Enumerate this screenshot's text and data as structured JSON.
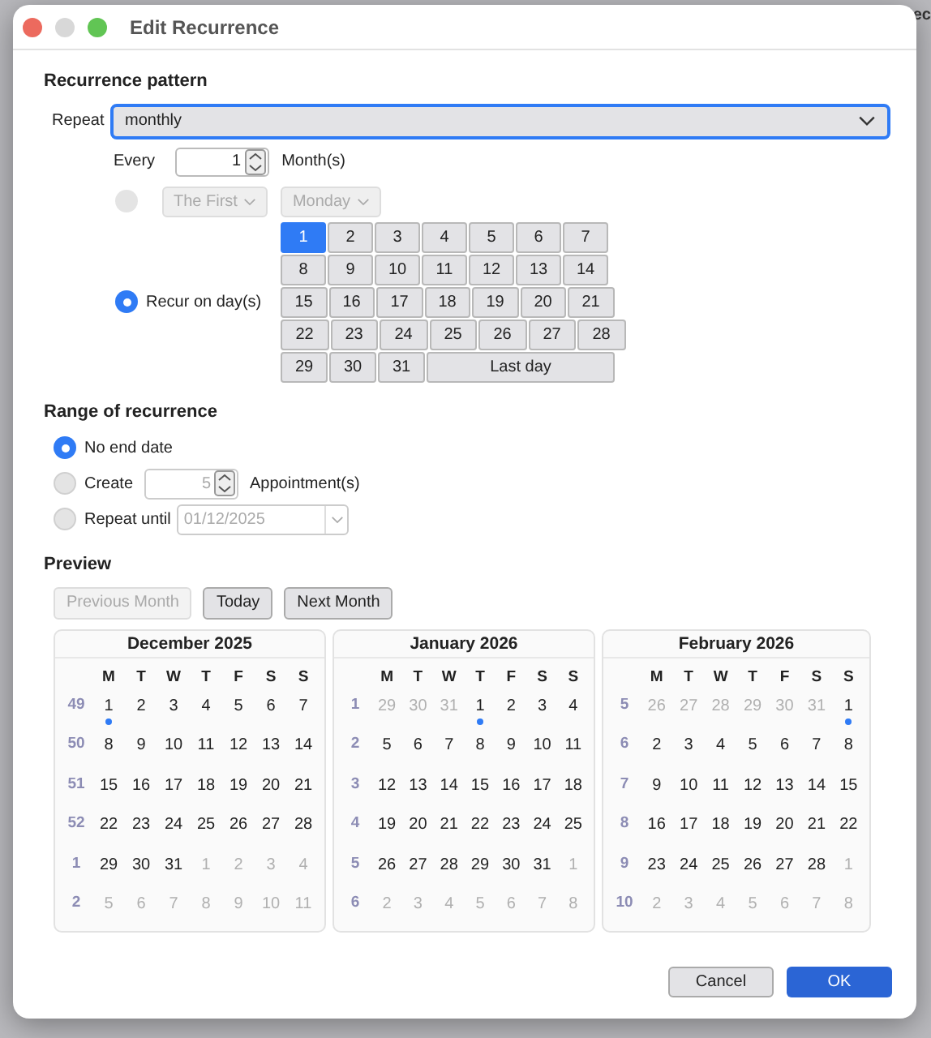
{
  "background": {
    "text_fragment": "ec"
  },
  "window": {
    "title": "Edit Recurrence"
  },
  "pattern": {
    "heading": "Recurrence pattern",
    "repeat_label": "Repeat",
    "repeat_value": "monthly",
    "every_label": "Every",
    "every_value": "1",
    "every_unit": "Month(s)",
    "weekday_option": {
      "selected": false,
      "disabled": true,
      "ordinal": "The First",
      "weekday": "Monday"
    },
    "days_option": {
      "selected": true,
      "label": "Recur on day(s)"
    },
    "day_rows": [
      [
        {
          "label": "1",
          "selected": true
        },
        {
          "label": "2",
          "selected": false
        },
        {
          "label": "3",
          "selected": false
        },
        {
          "label": "4",
          "selected": false
        },
        {
          "label": "5",
          "selected": false
        },
        {
          "label": "6",
          "selected": false
        },
        {
          "label": "7",
          "selected": false
        }
      ],
      [
        {
          "label": "8",
          "selected": false
        },
        {
          "label": "9",
          "selected": false
        },
        {
          "label": "10",
          "selected": false
        },
        {
          "label": "11",
          "selected": false
        },
        {
          "label": "12",
          "selected": false
        },
        {
          "label": "13",
          "selected": false
        },
        {
          "label": "14",
          "selected": false
        }
      ],
      [
        {
          "label": "15",
          "selected": false
        },
        {
          "label": "16",
          "selected": false
        },
        {
          "label": "17",
          "selected": false
        },
        {
          "label": "18",
          "selected": false
        },
        {
          "label": "19",
          "selected": false
        },
        {
          "label": "20",
          "selected": false
        },
        {
          "label": "21",
          "selected": false
        }
      ],
      [
        {
          "label": "22",
          "selected": false
        },
        {
          "label": "23",
          "selected": false
        },
        {
          "label": "24",
          "selected": false
        },
        {
          "label": "25",
          "selected": false
        },
        {
          "label": "26",
          "selected": false
        },
        {
          "label": "27",
          "selected": false
        },
        {
          "label": "28",
          "selected": false
        }
      ],
      [
        {
          "label": "29",
          "selected": false
        },
        {
          "label": "30",
          "selected": false
        },
        {
          "label": "31",
          "selected": false
        },
        {
          "label": "Last day",
          "selected": false,
          "kind": "wide"
        }
      ]
    ]
  },
  "range": {
    "heading": "Range of recurrence",
    "options": [
      {
        "kind": "plain",
        "label": "No end date",
        "selected": true
      },
      {
        "kind": "count",
        "label": "Create",
        "value": "5",
        "unit": "Appointment(s)",
        "selected": false
      },
      {
        "kind": "date",
        "label": "Repeat until",
        "value": "01/12/2025",
        "selected": false
      }
    ]
  },
  "preview": {
    "heading": "Preview",
    "buttons": [
      {
        "label": "Previous Month",
        "disabled": true
      },
      {
        "label": "Today",
        "disabled": false
      },
      {
        "label": "Next Month",
        "disabled": false
      }
    ],
    "months": [
      {
        "title": "December 2025",
        "weekdays": [
          "M",
          "T",
          "W",
          "T",
          "F",
          "S",
          "S"
        ],
        "weeks": [
          {
            "week": "49",
            "days": [
              {
                "d": "1",
                "other": false,
                "marked": true
              },
              {
                "d": "2",
                "other": false,
                "marked": false
              },
              {
                "d": "3",
                "other": false,
                "marked": false
              },
              {
                "d": "4",
                "other": false,
                "marked": false
              },
              {
                "d": "5",
                "other": false,
                "marked": false
              },
              {
                "d": "6",
                "other": false,
                "marked": false
              },
              {
                "d": "7",
                "other": false,
                "marked": false
              }
            ]
          },
          {
            "week": "50",
            "days": [
              {
                "d": "8",
                "other": false,
                "marked": false
              },
              {
                "d": "9",
                "other": false,
                "marked": false
              },
              {
                "d": "10",
                "other": false,
                "marked": false
              },
              {
                "d": "11",
                "other": false,
                "marked": false
              },
              {
                "d": "12",
                "other": false,
                "marked": false
              },
              {
                "d": "13",
                "other": false,
                "marked": false
              },
              {
                "d": "14",
                "other": false,
                "marked": false
              }
            ]
          },
          {
            "week": "51",
            "days": [
              {
                "d": "15",
                "other": false,
                "marked": false
              },
              {
                "d": "16",
                "other": false,
                "marked": false
              },
              {
                "d": "17",
                "other": false,
                "marked": false
              },
              {
                "d": "18",
                "other": false,
                "marked": false
              },
              {
                "d": "19",
                "other": false,
                "marked": false
              },
              {
                "d": "20",
                "other": false,
                "marked": false
              },
              {
                "d": "21",
                "other": false,
                "marked": false
              }
            ]
          },
          {
            "week": "52",
            "days": [
              {
                "d": "22",
                "other": false,
                "marked": false
              },
              {
                "d": "23",
                "other": false,
                "marked": false
              },
              {
                "d": "24",
                "other": false,
                "marked": false
              },
              {
                "d": "25",
                "other": false,
                "marked": false
              },
              {
                "d": "26",
                "other": false,
                "marked": false
              },
              {
                "d": "27",
                "other": false,
                "marked": false
              },
              {
                "d": "28",
                "other": false,
                "marked": false
              }
            ]
          },
          {
            "week": "1",
            "days": [
              {
                "d": "29",
                "other": false,
                "marked": false
              },
              {
                "d": "30",
                "other": false,
                "marked": false
              },
              {
                "d": "31",
                "other": false,
                "marked": false
              },
              {
                "d": "1",
                "other": true,
                "marked": false
              },
              {
                "d": "2",
                "other": true,
                "marked": false
              },
              {
                "d": "3",
                "other": true,
                "marked": false
              },
              {
                "d": "4",
                "other": true,
                "marked": false
              }
            ]
          },
          {
            "week": "2",
            "days": [
              {
                "d": "5",
                "other": true,
                "marked": false
              },
              {
                "d": "6",
                "other": true,
                "marked": false
              },
              {
                "d": "7",
                "other": true,
                "marked": false
              },
              {
                "d": "8",
                "other": true,
                "marked": false
              },
              {
                "d": "9",
                "other": true,
                "marked": false
              },
              {
                "d": "10",
                "other": true,
                "marked": false
              },
              {
                "d": "11",
                "other": true,
                "marked": false
              }
            ]
          }
        ]
      },
      {
        "title": "January 2026",
        "weekdays": [
          "M",
          "T",
          "W",
          "T",
          "F",
          "S",
          "S"
        ],
        "weeks": [
          {
            "week": "1",
            "days": [
              {
                "d": "29",
                "other": true,
                "marked": false
              },
              {
                "d": "30",
                "other": true,
                "marked": false
              },
              {
                "d": "31",
                "other": true,
                "marked": false
              },
              {
                "d": "1",
                "other": false,
                "marked": true
              },
              {
                "d": "2",
                "other": false,
                "marked": false
              },
              {
                "d": "3",
                "other": false,
                "marked": false
              },
              {
                "d": "4",
                "other": false,
                "marked": false
              }
            ]
          },
          {
            "week": "2",
            "days": [
              {
                "d": "5",
                "other": false,
                "marked": false
              },
              {
                "d": "6",
                "other": false,
                "marked": false
              },
              {
                "d": "7",
                "other": false,
                "marked": false
              },
              {
                "d": "8",
                "other": false,
                "marked": false
              },
              {
                "d": "9",
                "other": false,
                "marked": false
              },
              {
                "d": "10",
                "other": false,
                "marked": false
              },
              {
                "d": "11",
                "other": false,
                "marked": false
              }
            ]
          },
          {
            "week": "3",
            "days": [
              {
                "d": "12",
                "other": false,
                "marked": false
              },
              {
                "d": "13",
                "other": false,
                "marked": false
              },
              {
                "d": "14",
                "other": false,
                "marked": false
              },
              {
                "d": "15",
                "other": false,
                "marked": false
              },
              {
                "d": "16",
                "other": false,
                "marked": false
              },
              {
                "d": "17",
                "other": false,
                "marked": false
              },
              {
                "d": "18",
                "other": false,
                "marked": false
              }
            ]
          },
          {
            "week": "4",
            "days": [
              {
                "d": "19",
                "other": false,
                "marked": false
              },
              {
                "d": "20",
                "other": false,
                "marked": false
              },
              {
                "d": "21",
                "other": false,
                "marked": false
              },
              {
                "d": "22",
                "other": false,
                "marked": false
              },
              {
                "d": "23",
                "other": false,
                "marked": false
              },
              {
                "d": "24",
                "other": false,
                "marked": false
              },
              {
                "d": "25",
                "other": false,
                "marked": false
              }
            ]
          },
          {
            "week": "5",
            "days": [
              {
                "d": "26",
                "other": false,
                "marked": false
              },
              {
                "d": "27",
                "other": false,
                "marked": false
              },
              {
                "d": "28",
                "other": false,
                "marked": false
              },
              {
                "d": "29",
                "other": false,
                "marked": false
              },
              {
                "d": "30",
                "other": false,
                "marked": false
              },
              {
                "d": "31",
                "other": false,
                "marked": false
              },
              {
                "d": "1",
                "other": true,
                "marked": false
              }
            ]
          },
          {
            "week": "6",
            "days": [
              {
                "d": "2",
                "other": true,
                "marked": false
              },
              {
                "d": "3",
                "other": true,
                "marked": false
              },
              {
                "d": "4",
                "other": true,
                "marked": false
              },
              {
                "d": "5",
                "other": true,
                "marked": false
              },
              {
                "d": "6",
                "other": true,
                "marked": false
              },
              {
                "d": "7",
                "other": true,
                "marked": false
              },
              {
                "d": "8",
                "other": true,
                "marked": false
              }
            ]
          }
        ]
      },
      {
        "title": "February 2026",
        "weekdays": [
          "M",
          "T",
          "W",
          "T",
          "F",
          "S",
          "S"
        ],
        "weeks": [
          {
            "week": "5",
            "days": [
              {
                "d": "26",
                "other": true,
                "marked": false
              },
              {
                "d": "27",
                "other": true,
                "marked": false
              },
              {
                "d": "28",
                "other": true,
                "marked": false
              },
              {
                "d": "29",
                "other": true,
                "marked": false
              },
              {
                "d": "30",
                "other": true,
                "marked": false
              },
              {
                "d": "31",
                "other": true,
                "marked": false
              },
              {
                "d": "1",
                "other": false,
                "marked": true
              }
            ]
          },
          {
            "week": "6",
            "days": [
              {
                "d": "2",
                "other": false,
                "marked": false
              },
              {
                "d": "3",
                "other": false,
                "marked": false
              },
              {
                "d": "4",
                "other": false,
                "marked": false
              },
              {
                "d": "5",
                "other": false,
                "marked": false
              },
              {
                "d": "6",
                "other": false,
                "marked": false
              },
              {
                "d": "7",
                "other": false,
                "marked": false
              },
              {
                "d": "8",
                "other": false,
                "marked": false
              }
            ]
          },
          {
            "week": "7",
            "days": [
              {
                "d": "9",
                "other": false,
                "marked": false
              },
              {
                "d": "10",
                "other": false,
                "marked": false
              },
              {
                "d": "11",
                "other": false,
                "marked": false
              },
              {
                "d": "12",
                "other": false,
                "marked": false
              },
              {
                "d": "13",
                "other": false,
                "marked": false
              },
              {
                "d": "14",
                "other": false,
                "marked": false
              },
              {
                "d": "15",
                "other": false,
                "marked": false
              }
            ]
          },
          {
            "week": "8",
            "days": [
              {
                "d": "16",
                "other": false,
                "marked": false
              },
              {
                "d": "17",
                "other": false,
                "marked": false
              },
              {
                "d": "18",
                "other": false,
                "marked": false
              },
              {
                "d": "19",
                "other": false,
                "marked": false
              },
              {
                "d": "20",
                "other": false,
                "marked": false
              },
              {
                "d": "21",
                "other": false,
                "marked": false
              },
              {
                "d": "22",
                "other": false,
                "marked": false
              }
            ]
          },
          {
            "week": "9",
            "days": [
              {
                "d": "23",
                "other": false,
                "marked": false
              },
              {
                "d": "24",
                "other": false,
                "marked": false
              },
              {
                "d": "25",
                "other": false,
                "marked": false
              },
              {
                "d": "26",
                "other": false,
                "marked": false
              },
              {
                "d": "27",
                "other": false,
                "marked": false
              },
              {
                "d": "28",
                "other": false,
                "marked": false
              },
              {
                "d": "1",
                "other": true,
                "marked": false
              }
            ]
          },
          {
            "week": "10",
            "days": [
              {
                "d": "2",
                "other": true,
                "marked": false
              },
              {
                "d": "3",
                "other": true,
                "marked": false
              },
              {
                "d": "4",
                "other": true,
                "marked": false
              },
              {
                "d": "5",
                "other": true,
                "marked": false
              },
              {
                "d": "6",
                "other": true,
                "marked": false
              },
              {
                "d": "7",
                "other": true,
                "marked": false
              },
              {
                "d": "8",
                "other": true,
                "marked": false
              }
            ]
          }
        ]
      }
    ]
  },
  "footer": {
    "buttons": [
      {
        "label": "Cancel",
        "kind": "secondary"
      },
      {
        "label": "OK",
        "kind": "primary"
      }
    ]
  }
}
